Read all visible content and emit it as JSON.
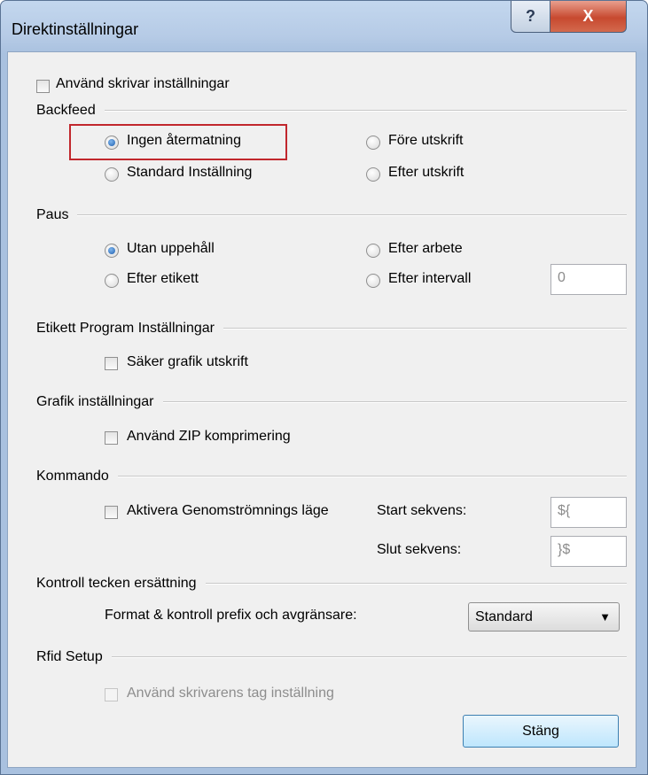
{
  "window": {
    "title": "Direktinställningar",
    "help_label": "?",
    "close_label": "X"
  },
  "use_printer_settings": {
    "label": "Använd skrivar inställningar",
    "checked": false
  },
  "backfeed": {
    "heading": "Backfeed",
    "options": [
      {
        "label": "Ingen återmatning",
        "selected": true
      },
      {
        "label": "Före utskrift",
        "selected": false
      },
      {
        "label": "Standard Inställning",
        "selected": false
      },
      {
        "label": "Efter utskrift",
        "selected": false
      }
    ]
  },
  "pause": {
    "heading": "Paus",
    "options": [
      {
        "label": "Utan uppehåll",
        "selected": true
      },
      {
        "label": "Efter arbete",
        "selected": false
      },
      {
        "label": "Efter etikett",
        "selected": false
      },
      {
        "label": "Efter intervall",
        "selected": false
      }
    ],
    "interval_value": "0"
  },
  "label_program": {
    "heading": "Etikett Program Inställningar",
    "safe_graphics_label": "Säker grafik utskrift"
  },
  "graphics": {
    "heading": "Grafik inställningar",
    "zip_label": "Använd ZIP komprimering"
  },
  "command": {
    "heading": "Kommando",
    "passthrough_label": "Aktivera Genomströmnings läge",
    "start_label": "Start sekvens:",
    "start_value": "${",
    "end_label": "Slut sekvens:",
    "end_value": "}$"
  },
  "control_chars": {
    "heading": "Kontroll tecken ersättning",
    "format_label": "Format & kontroll prefix och avgränsare:",
    "format_value": "Standard"
  },
  "rfid": {
    "heading": "Rfid Setup",
    "tag_label": "Använd skrivarens tag inställning"
  },
  "close_button_label": "Stäng",
  "icons": {
    "dropdown": "chevron-down-icon",
    "help": "help-icon",
    "close": "close-icon"
  },
  "colors": {
    "highlight": "#c1272d",
    "title_bar": "#b6cbe6"
  }
}
